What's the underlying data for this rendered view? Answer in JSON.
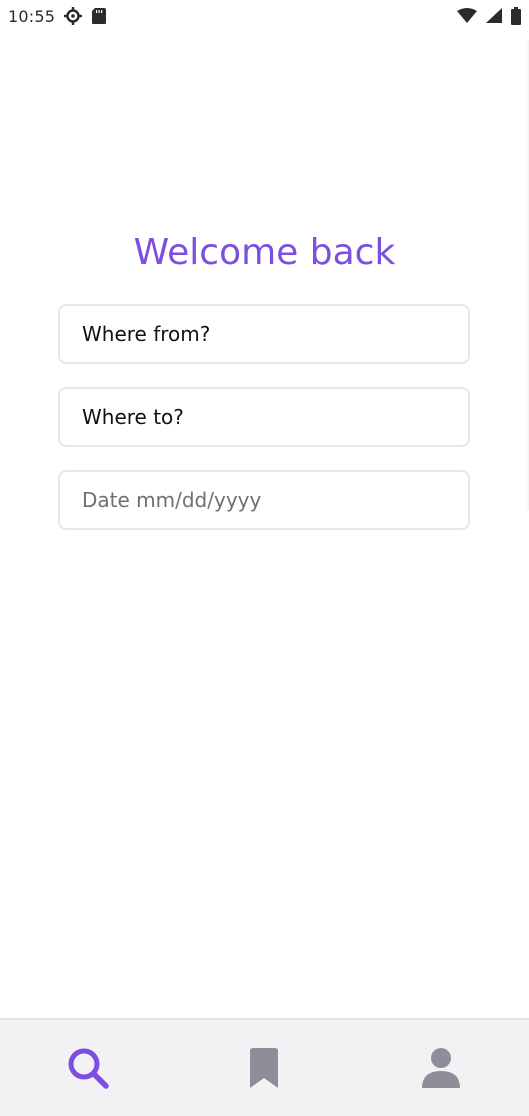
{
  "status_bar": {
    "time": "10:55",
    "icons": [
      "settings-icon",
      "sd-card-icon",
      "wifi-icon",
      "signal-icon",
      "battery-icon"
    ]
  },
  "main": {
    "title": "Welcome back",
    "fields": {
      "from_value": "Where from?",
      "to_value": "Where to?",
      "date_placeholder": "Date mm/dd/yyyy"
    }
  },
  "bottom_nav": {
    "items": [
      {
        "icon": "search-icon",
        "active": true
      },
      {
        "icon": "bookmark-icon",
        "active": false
      },
      {
        "icon": "profile-icon",
        "active": false
      }
    ],
    "active_color": "#7c4fe0",
    "inactive_color": "#8e8e99"
  },
  "colors": {
    "accent": "#7c4fe0",
    "field_border": "#e7e7e7",
    "nav_background": "#f2f2f4"
  }
}
